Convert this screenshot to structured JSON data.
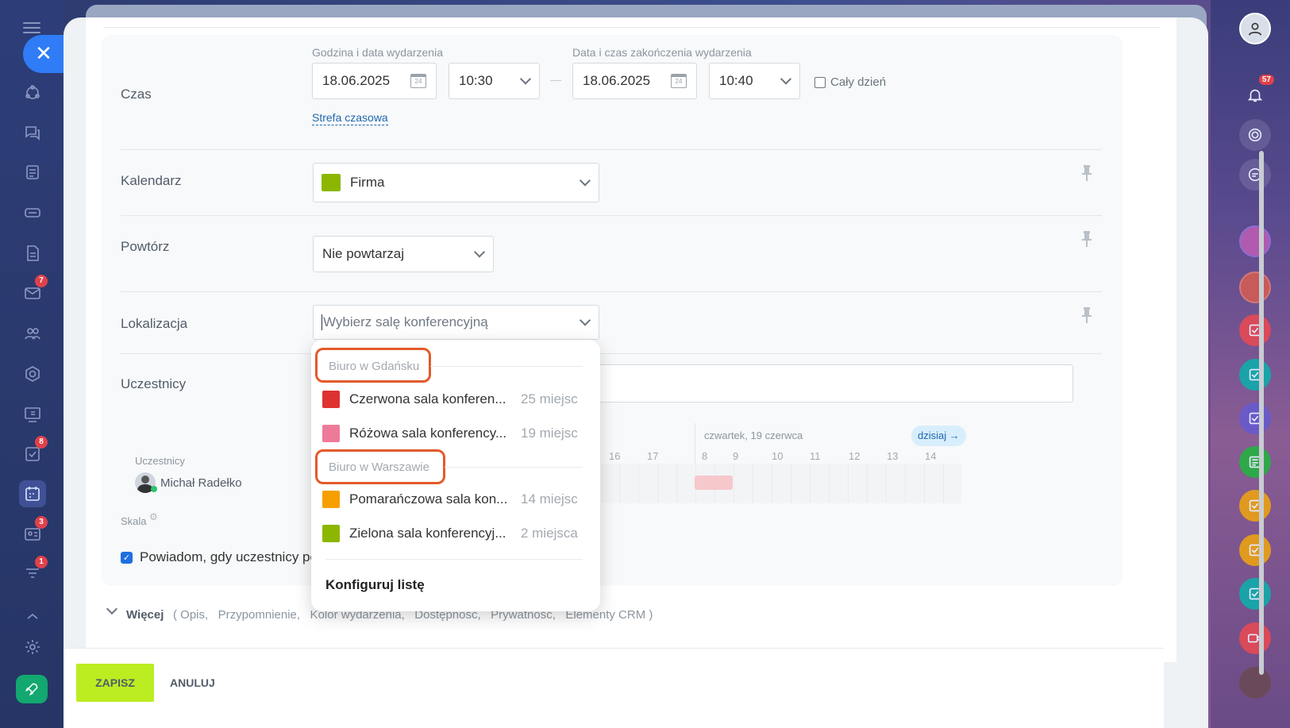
{
  "left_nav": {
    "badges": {
      "mail": "7",
      "tasks": "8",
      "crm": "3",
      "feed": "1"
    }
  },
  "right_nav": {
    "notifications_badge": "57"
  },
  "form": {
    "time": {
      "label": "Czas",
      "start_caption": "Godzina i data wydarzenia",
      "end_caption": "Data i czas zakończenia wydarzenia",
      "start_date": "18.06.2025",
      "start_time": "10:30",
      "end_date": "18.06.2025",
      "end_time": "10:40",
      "dash": "—",
      "all_day_label": "Cały dzień",
      "timezone_link": "Strefa czasowa",
      "calendar_icon_day": "24"
    },
    "calendar": {
      "label": "Kalendarz",
      "value": "Firma",
      "color": "#8db600"
    },
    "repeat": {
      "label": "Powtórz",
      "value": "Nie powtarzaj"
    },
    "location": {
      "label": "Lokalizacja",
      "placeholder": "Wybierz salę konferencyjną"
    },
    "attendees": {
      "label": "Uczestnicy",
      "list_caption": "Uczestnicy",
      "person": "Michał Radełko",
      "scale_label": "Skala",
      "day_label": "czwartek, 19 czerwca",
      "today_button": "dzisiaj →",
      "hours_left": [
        "16",
        "17"
      ],
      "hours_right": [
        "8",
        "9",
        "10",
        "11",
        "12",
        "13",
        "14"
      ]
    },
    "notify_label": "Powiadom, gdy uczestnicy po",
    "more": {
      "label": "Więcej",
      "items": "( Opis,   Przypomnienie,   Kolor wydarzenia,   Dostępność,   Prywatność,   Elementy CRM )"
    }
  },
  "dropdown": {
    "groups": [
      {
        "title": "Biuro w Gdańsku",
        "rooms": [
          {
            "name": "Czerwona sala konferen...",
            "capacity": "25 miejsc",
            "color": "#e03131"
          },
          {
            "name": "Różowa sala konferency...",
            "capacity": "19 miejsc",
            "color": "#ee7a9a"
          }
        ]
      },
      {
        "title": "Biuro w Warszawie",
        "rooms": [
          {
            "name": "Pomarańczowa sala kon...",
            "capacity": "14 miejsc",
            "color": "#f5a000"
          },
          {
            "name": "Zielona sala konferencyj...",
            "capacity": "2 miejsca",
            "color": "#8db600"
          }
        ]
      }
    ],
    "configure_label": "Konfiguruj listę"
  },
  "footer": {
    "save_label": "ZAPISZ",
    "cancel_label": "ANULUJ"
  }
}
